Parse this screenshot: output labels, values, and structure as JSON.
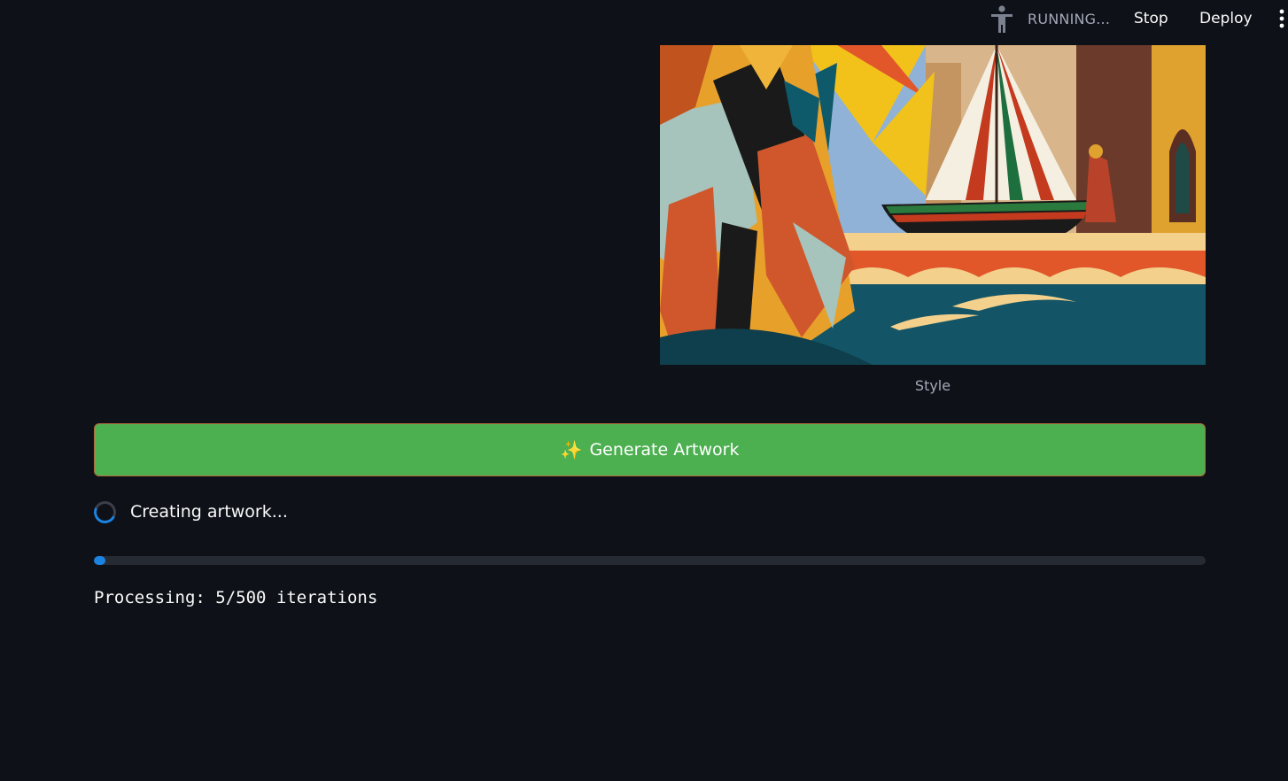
{
  "header": {
    "status_text": "RUNNING...",
    "stop_label": "Stop",
    "deploy_label": "Deploy",
    "status_icon": "running-man-icon",
    "menu_icon": "kebab-menu-icon"
  },
  "style_image": {
    "caption": "Style"
  },
  "generate_button": {
    "icon": "sparkles-icon",
    "label": "Generate Artwork"
  },
  "spinner": {
    "text": "Creating artwork..."
  },
  "progress": {
    "value": 0.01
  },
  "processing": {
    "text": "Processing: 5/500 iterations"
  },
  "colors": {
    "background": "#0e1117",
    "button_green": "#4caf50",
    "accent_blue": "#1c83e1",
    "track": "#262a33"
  }
}
